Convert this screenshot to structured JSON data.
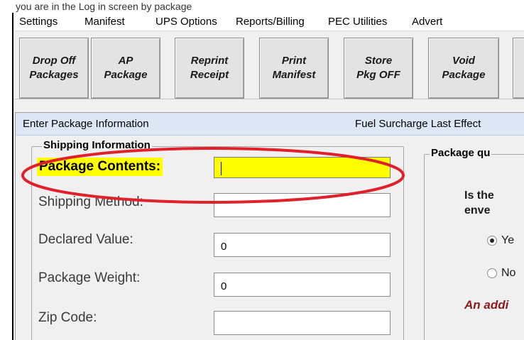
{
  "caption": "you are in the Log in screen by package",
  "menu": [
    "Settings",
    "Manifest",
    "UPS Options",
    "Reports/Billing",
    "PEC Utilities",
    "Advert"
  ],
  "toolbar": [
    {
      "line1": "Drop Off",
      "line2": "Packages"
    },
    {
      "line1": "AP",
      "line2": "Package"
    },
    {
      "line1": "Reprint",
      "line2": "Receipt"
    },
    {
      "line1": "Print",
      "line2": "Manifest"
    },
    {
      "line1": "Store",
      "line2": "Pkg OFF"
    },
    {
      "line1": "Void",
      "line2": "Package"
    }
  ],
  "panel": {
    "title": "Enter Package Information",
    "right_title": "Fuel Surcharge Last Effect"
  },
  "shipping": {
    "group_title": "Shipping Information",
    "fields": [
      {
        "label": "Package Contents:",
        "value": ""
      },
      {
        "label": "Shipping Method:",
        "value": ""
      },
      {
        "label": "Declared Value:",
        "value": "0"
      },
      {
        "label": "Package Weight:",
        "value": "0"
      },
      {
        "label": "Zip Code:",
        "value": ""
      }
    ]
  },
  "package_question": {
    "group_title": "Package qu",
    "question_line1": "Is the",
    "question_line2": "enve",
    "options": [
      {
        "label": "Ye",
        "checked": true
      },
      {
        "label": "No",
        "checked": false
      }
    ],
    "note": "An addi"
  },
  "colors": {
    "highlight": "#ffff00",
    "annotation_ellipse": "#e0202a",
    "note_text": "#8b1a1a",
    "panel_header": "#dce6f4"
  }
}
